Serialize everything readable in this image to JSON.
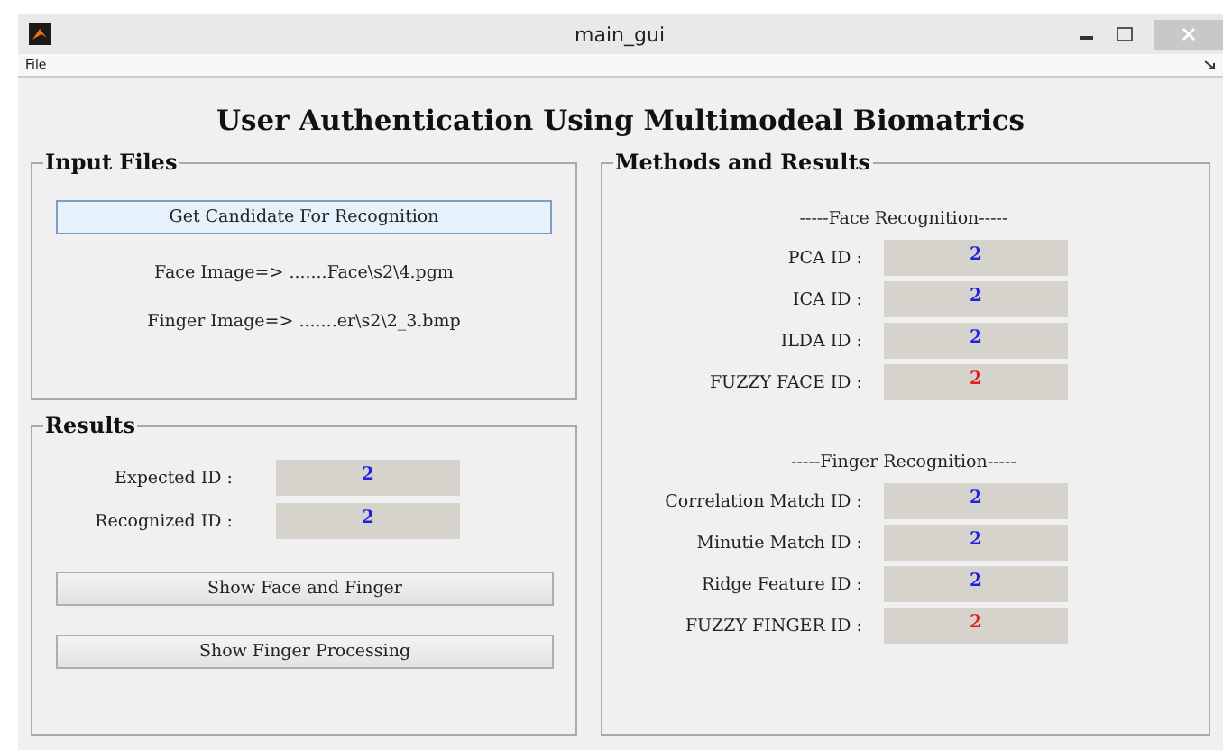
{
  "window": {
    "title": "main_gui"
  },
  "menu": [
    "File"
  ],
  "heading": "User Authentication Using Multimodeal Biomatrics",
  "input_files": {
    "title": "Input Files",
    "button": {
      "label": "Get Candidate For Recognition",
      "focused": true
    },
    "lines": [
      "Face Image=> .......Face\\s2\\4.pgm",
      "Finger Image=> .......er\\s2\\2_3.bmp"
    ]
  },
  "results": {
    "title": "Results",
    "fields": [
      {
        "label": "Expected ID :",
        "value": "2",
        "color": "#2020e0"
      },
      {
        "label": "Recognized ID :",
        "value": "2",
        "color": "#2020e0"
      }
    ],
    "buttons": [
      {
        "label": "Show Face and Finger",
        "focused": false
      },
      {
        "label": "Show Finger Processing",
        "focused": false
      }
    ]
  },
  "methods": {
    "title": "Methods and Results",
    "sections": [
      {
        "title": "-----Face Recognition-----",
        "fields": [
          {
            "label": "PCA ID :",
            "value": "2",
            "color": "#2020e0"
          },
          {
            "label": "ICA ID :",
            "value": "2",
            "color": "#2020e0"
          },
          {
            "label": "ILDA ID :",
            "value": "2",
            "color": "#2020e0"
          },
          {
            "label": "FUZZY FACE ID :",
            "value": "2",
            "color": "#e02020"
          }
        ]
      },
      {
        "title": "-----Finger Recognition-----",
        "fields": [
          {
            "label": "Correlation Match ID :",
            "value": "2",
            "color": "#2020e0"
          },
          {
            "label": "Minutie Match ID :",
            "value": "2",
            "color": "#2020e0"
          },
          {
            "label": "Ridge Feature ID :",
            "value": "2",
            "color": "#2020e0"
          },
          {
            "label": "FUZZY FINGER ID :",
            "value": "2",
            "color": "#e02020"
          }
        ]
      }
    ]
  }
}
